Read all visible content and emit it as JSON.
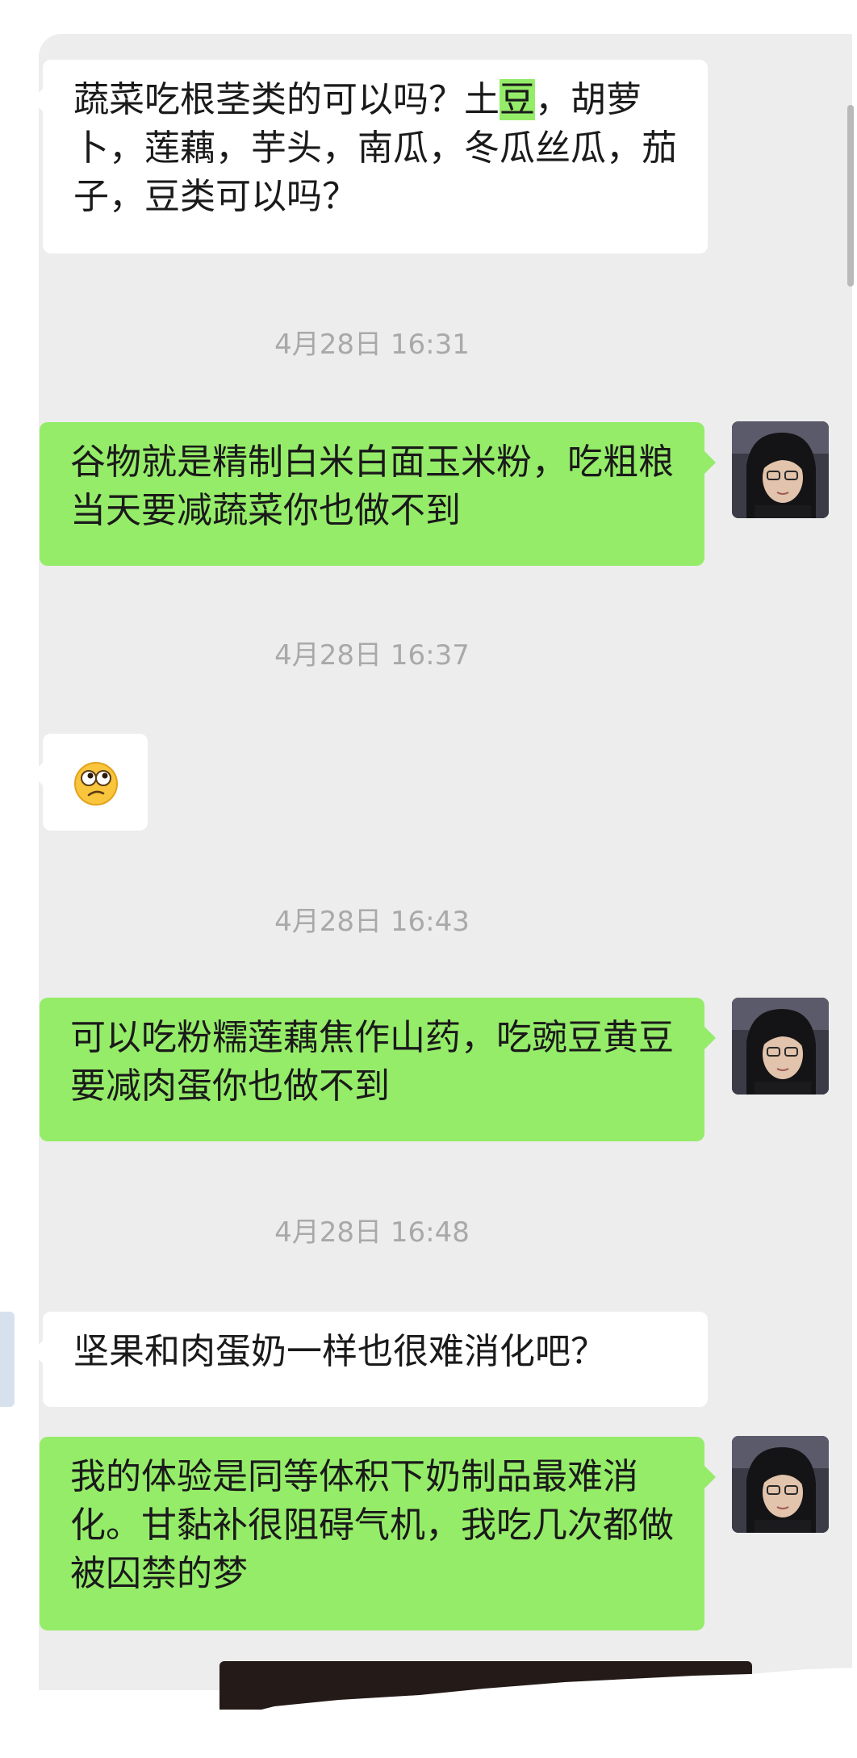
{
  "messages": [
    {
      "direction": "in",
      "text_before": "蔬菜吃根茎类的可以吗？土",
      "highlight": "豆",
      "text_after": "，胡萝卜，莲藕，芋头，南瓜，冬瓜丝瓜，茄子，豆类可以吗？"
    },
    {
      "direction": "out",
      "text": "谷物就是精制白米白面玉米粉，吃粗粮当天要减蔬菜你也做不到"
    },
    {
      "direction": "in",
      "emoji": "confused-face"
    },
    {
      "direction": "out",
      "text": "可以吃粉糯莲藕焦作山药，吃豌豆黄豆要减肉蛋你也做不到"
    },
    {
      "direction": "in",
      "text": "坚果和肉蛋奶一样也很难消化吧？"
    },
    {
      "direction": "out",
      "text": "我的体验是同等体积下奶制品最难消化。甘黏补很阻碍气机，我吃几次都做被囚禁的梦"
    }
  ],
  "timestamps": [
    "4月28日 16:31",
    "4月28日 16:37",
    "4月28日 16:43",
    "4月28日 16:48"
  ],
  "colors": {
    "outgoing_bubble": "#95ec69",
    "incoming_bubble": "#ffffff",
    "chat_background": "#ededed",
    "timestamp_text": "#a9a9a9"
  }
}
